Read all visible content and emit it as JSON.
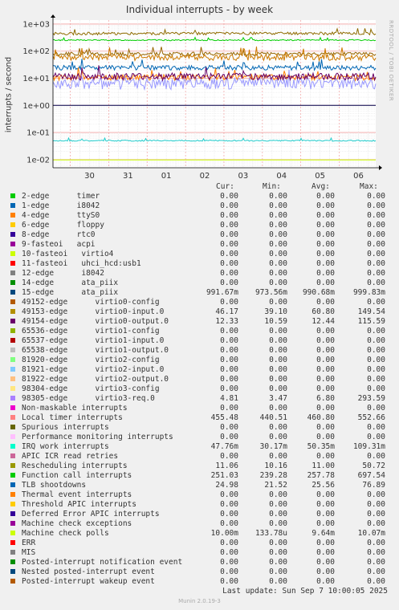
{
  "title": "Individual interrupts - by week",
  "sidebar": "RRDTOOL / TOBI OETIKER",
  "ylabel": "interrupts / second",
  "footer": "Munin 2.0.19-3",
  "last_update": "Last update:  Sun Sep  7 10:00:05 2025",
  "headers": {
    "cur": "Cur:",
    "min": "Min:",
    "avg": "Avg:",
    "max": "Max:"
  },
  "chart_data": {
    "type": "line",
    "title": "Individual interrupts - by week",
    "ylabel": "interrupts / second",
    "yscale": "log",
    "ylim": [
      0.005,
      1400
    ],
    "yticks": [
      {
        "v": 0.01,
        "label": "1e-02"
      },
      {
        "v": 0.1,
        "label": "1e-01"
      },
      {
        "v": 1,
        "label": "1e+00"
      },
      {
        "v": 10,
        "label": "1e+01"
      },
      {
        "v": 100,
        "label": "1e+02"
      },
      {
        "v": 1000,
        "label": "1e+03"
      }
    ],
    "xticks": [
      "30",
      "31",
      "01",
      "02",
      "03",
      "04",
      "05",
      "06"
    ],
    "grid": true,
    "series": [
      {
        "name": "Function call interrupts",
        "color": "#00cc00",
        "approx": 255,
        "spread": 0.05
      },
      {
        "name": "Local timer interrupts",
        "color": "#8f6c00",
        "approx": 450,
        "spread": 0.12
      },
      {
        "name": "Spurious interrupts",
        "color": "#996600",
        "approx": 80,
        "spread": 0.15
      },
      {
        "name": "15-edge ata_piix",
        "color": "#00004a",
        "approx": 1,
        "spread": 0.0
      },
      {
        "name": "IRQ work interrupts",
        "color": "#22cccc",
        "approx": 0.05,
        "spread": 0.05
      },
      {
        "name": "Machine check polls",
        "color": "#ccff00",
        "approx": 0.0097,
        "spread": 0.0
      },
      {
        "name": "TLB shootdowns",
        "color": "#0066b3",
        "approx": 25,
        "spread": 0.2
      },
      {
        "name": "Rescheduling interrupts",
        "color": "#ff8000",
        "approx": 11,
        "spread": 0.25
      },
      {
        "name": "49153-edge virtio0-input.0",
        "color": "#cc7a00",
        "approx": 60,
        "spread": 0.25
      },
      {
        "name": "98305-edge virtio3-req.0",
        "color": "#9999ff",
        "approx": 7,
        "spread": 0.45
      },
      {
        "name": "49154-edge virtio0-output.0",
        "color": "#660066",
        "approx": 12,
        "spread": 0.3
      }
    ]
  },
  "legend": [
    {
      "color": "#00cc00",
      "name": "2-edge      timer",
      "cur": "0.00",
      "min": "0.00",
      "avg": "0.00",
      "max": "0.00"
    },
    {
      "color": "#0066b3",
      "name": "1-edge      i8042",
      "cur": "0.00",
      "min": "0.00",
      "avg": "0.00",
      "max": "0.00"
    },
    {
      "color": "#ff8000",
      "name": "4-edge      ttyS0",
      "cur": "0.00",
      "min": "0.00",
      "avg": "0.00",
      "max": "0.00"
    },
    {
      "color": "#ffcc00",
      "name": "6-edge      floppy",
      "cur": "0.00",
      "min": "0.00",
      "avg": "0.00",
      "max": "0.00"
    },
    {
      "color": "#330099",
      "name": "8-edge      rtc0",
      "cur": "0.00",
      "min": "0.00",
      "avg": "0.00",
      "max": "0.00"
    },
    {
      "color": "#990099",
      "name": "9-fasteoi   acpi",
      "cur": "0.00",
      "min": "0.00",
      "avg": "0.00",
      "max": "0.00"
    },
    {
      "color": "#ccff00",
      "name": "10-fasteoi   virtio4",
      "cur": "0.00",
      "min": "0.00",
      "avg": "0.00",
      "max": "0.00"
    },
    {
      "color": "#ff0000",
      "name": "11-fasteoi   uhci_hcd:usb1",
      "cur": "0.00",
      "min": "0.00",
      "avg": "0.00",
      "max": "0.00"
    },
    {
      "color": "#808080",
      "name": "12-edge      i8042",
      "cur": "0.00",
      "min": "0.00",
      "avg": "0.00",
      "max": "0.00"
    },
    {
      "color": "#008f00",
      "name": "14-edge      ata_piix",
      "cur": "0.00",
      "min": "0.00",
      "avg": "0.00",
      "max": "0.00"
    },
    {
      "color": "#00487d",
      "name": "15-edge      ata_piix",
      "cur": "991.67m",
      "min": "973.56m",
      "avg": "990.68m",
      "max": "999.83m"
    },
    {
      "color": "#b35a00",
      "name": "49152-edge      virtio0-config",
      "cur": "0.00",
      "min": "0.00",
      "avg": "0.00",
      "max": "0.00"
    },
    {
      "color": "#b38f00",
      "name": "49153-edge      virtio0-input.0",
      "cur": "46.17",
      "min": "39.10",
      "avg": "60.80",
      "max": "149.54"
    },
    {
      "color": "#6b006b",
      "name": "49154-edge      virtio0-output.0",
      "cur": "12.33",
      "min": "10.59",
      "avg": "12.44",
      "max": "115.59"
    },
    {
      "color": "#8fb300",
      "name": "65536-edge      virtio1-config",
      "cur": "0.00",
      "min": "0.00",
      "avg": "0.00",
      "max": "0.00"
    },
    {
      "color": "#b30000",
      "name": "65537-edge      virtio1-input.0",
      "cur": "0.00",
      "min": "0.00",
      "avg": "0.00",
      "max": "0.00"
    },
    {
      "color": "#bebebe",
      "name": "65538-edge      virtio1-output.0",
      "cur": "0.00",
      "min": "0.00",
      "avg": "0.00",
      "max": "0.00"
    },
    {
      "color": "#80ff80",
      "name": "81920-edge      virtio2-config",
      "cur": "0.00",
      "min": "0.00",
      "avg": "0.00",
      "max": "0.00"
    },
    {
      "color": "#80c9ff",
      "name": "81921-edge      virtio2-input.0",
      "cur": "0.00",
      "min": "0.00",
      "avg": "0.00",
      "max": "0.00"
    },
    {
      "color": "#ffc080",
      "name": "81922-edge      virtio2-output.0",
      "cur": "0.00",
      "min": "0.00",
      "avg": "0.00",
      "max": "0.00"
    },
    {
      "color": "#ffe680",
      "name": "98304-edge      virtio3-config",
      "cur": "0.00",
      "min": "0.00",
      "avg": "0.00",
      "max": "0.00"
    },
    {
      "color": "#aa80ff",
      "name": "98305-edge      virtio3-req.0",
      "cur": "4.81",
      "min": "3.47",
      "avg": "6.80",
      "max": "293.59"
    },
    {
      "color": "#ee00cc",
      "name": "Non-maskable interrupts",
      "cur": "0.00",
      "min": "0.00",
      "avg": "0.00",
      "max": "0.00"
    },
    {
      "color": "#ff8080",
      "name": "Local timer interrupts",
      "cur": "455.48",
      "min": "440.51",
      "avg": "460.80",
      "max": "552.66"
    },
    {
      "color": "#666600",
      "name": "Spurious interrupts",
      "cur": "0.00",
      "min": "0.00",
      "avg": "0.00",
      "max": "0.00"
    },
    {
      "color": "#ffbfff",
      "name": "Performance monitoring interrupts",
      "cur": "0.00",
      "min": "0.00",
      "avg": "0.00",
      "max": "0.00"
    },
    {
      "color": "#00ffcc",
      "name": "IRQ work interrupts",
      "cur": "47.76m",
      "min": "30.17m",
      "avg": "50.35m",
      "max": "109.31m"
    },
    {
      "color": "#cc6699",
      "name": "APIC ICR read retries",
      "cur": "0.00",
      "min": "0.00",
      "avg": "0.00",
      "max": "0.00"
    },
    {
      "color": "#999900",
      "name": "Rescheduling interrupts",
      "cur": "11.06",
      "min": "10.16",
      "avg": "11.00",
      "max": "50.72"
    },
    {
      "color": "#00cc00",
      "name": "Function call interrupts",
      "cur": "251.03",
      "min": "239.28",
      "avg": "257.78",
      "max": "697.54"
    },
    {
      "color": "#0066b3",
      "name": "TLB shootdowns",
      "cur": "24.98",
      "min": "21.52",
      "avg": "25.56",
      "max": "76.89"
    },
    {
      "color": "#ff8000",
      "name": "Thermal event interrupts",
      "cur": "0.00",
      "min": "0.00",
      "avg": "0.00",
      "max": "0.00"
    },
    {
      "color": "#ffcc00",
      "name": "Threshold APIC interrupts",
      "cur": "0.00",
      "min": "0.00",
      "avg": "0.00",
      "max": "0.00"
    },
    {
      "color": "#330099",
      "name": "Deferred Error APIC interrupts",
      "cur": "0.00",
      "min": "0.00",
      "avg": "0.00",
      "max": "0.00"
    },
    {
      "color": "#990099",
      "name": "Machine check exceptions",
      "cur": "0.00",
      "min": "0.00",
      "avg": "0.00",
      "max": "0.00"
    },
    {
      "color": "#ccff00",
      "name": "Machine check polls",
      "cur": "10.00m",
      "min": "133.78u",
      "avg": "9.64m",
      "max": "10.07m"
    },
    {
      "color": "#ff0000",
      "name": "ERR",
      "cur": "0.00",
      "min": "0.00",
      "avg": "0.00",
      "max": "0.00"
    },
    {
      "color": "#808080",
      "name": "MIS",
      "cur": "0.00",
      "min": "0.00",
      "avg": "0.00",
      "max": "0.00"
    },
    {
      "color": "#008f00",
      "name": "Posted-interrupt notification event",
      "cur": "0.00",
      "min": "0.00",
      "avg": "0.00",
      "max": "0.00"
    },
    {
      "color": "#00487d",
      "name": "Nested posted-interrupt event",
      "cur": "0.00",
      "min": "0.00",
      "avg": "0.00",
      "max": "0.00"
    },
    {
      "color": "#b35a00",
      "name": "Posted-interrupt wakeup event",
      "cur": "0.00",
      "min": "0.00",
      "avg": "0.00",
      "max": "0.00"
    }
  ]
}
